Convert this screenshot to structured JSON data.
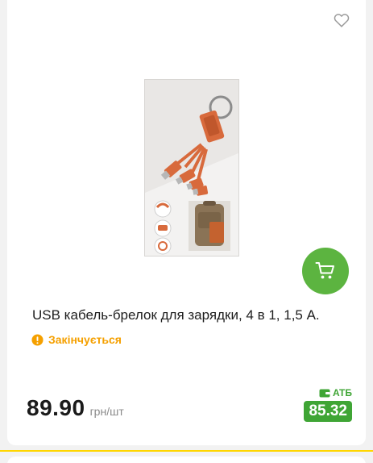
{
  "product": {
    "title": "USB кабель-брелок для зарядки, 4 в 1, 1,5 А.",
    "stock_status": "Закінчується",
    "price": "89.90",
    "unit": "грн/шт",
    "store_label": "АТБ",
    "store_price": "85.32"
  },
  "icons": {
    "wishlist": "heart-outline-icon",
    "cart": "cart-icon",
    "stock": "exclamation-circle-icon",
    "store": "wallet-icon"
  },
  "colors": {
    "accent_green": "#5cb440",
    "atb_green": "#3fa535",
    "warning_orange": "#f5a000",
    "divider_yellow": "#ffd600"
  }
}
